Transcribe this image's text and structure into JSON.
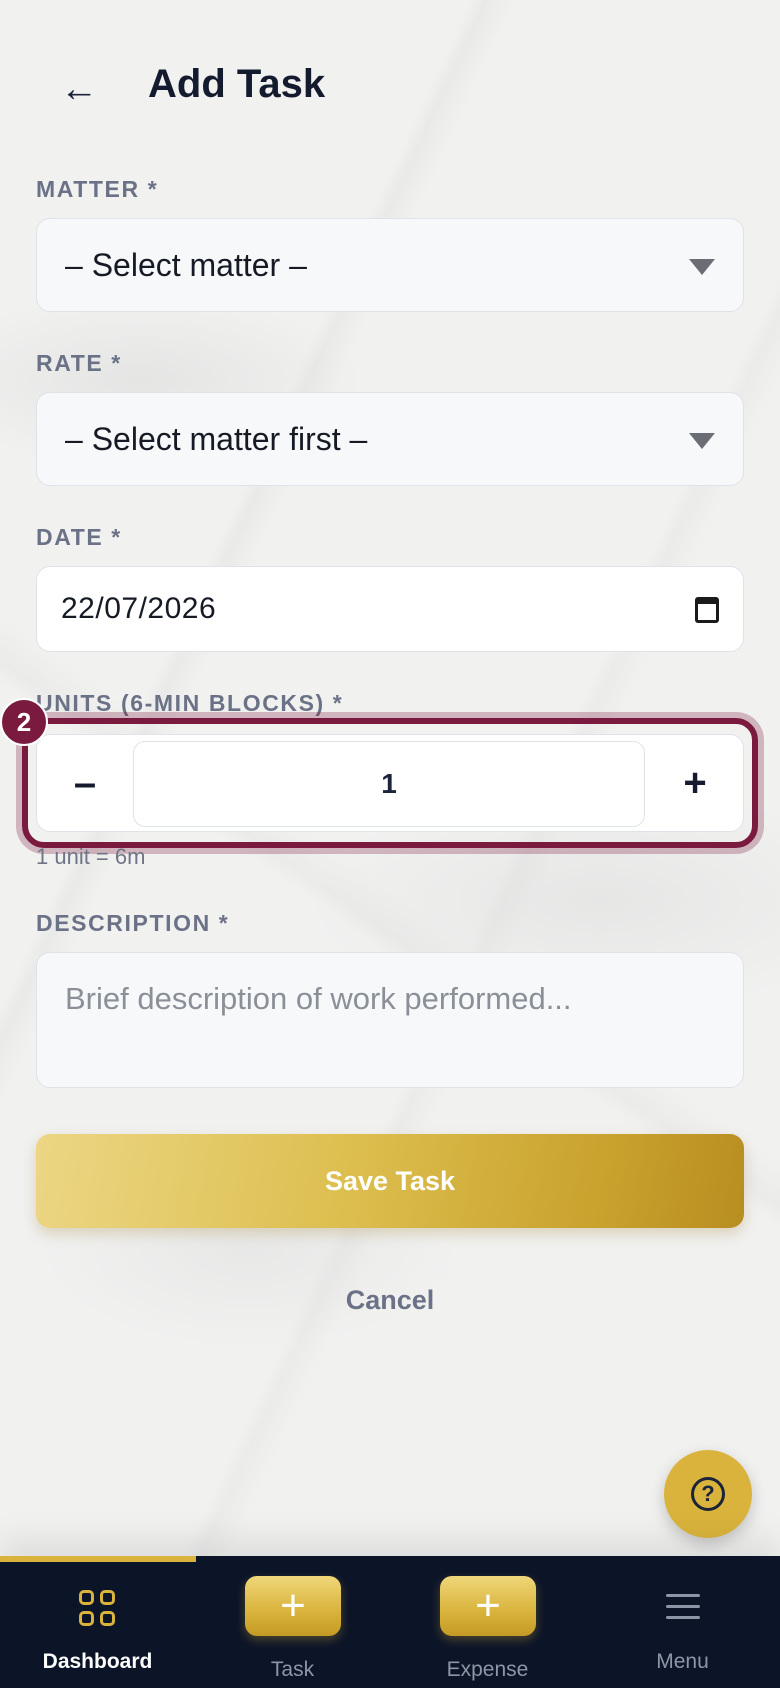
{
  "header": {
    "back_icon": "←",
    "title": "Add Task"
  },
  "form": {
    "matter": {
      "label": "MATTER *",
      "selected": "– Select matter –"
    },
    "rate": {
      "label": "RATE *",
      "selected": "– Select matter first –"
    },
    "date": {
      "label": "DATE *",
      "value": "22/07/2026"
    },
    "units": {
      "label": "UNITS (6-MIN BLOCKS) *",
      "minus": "–",
      "plus": "+",
      "value": "1",
      "hint": "1 unit = 6m",
      "badge": "2"
    },
    "description": {
      "label": "DESCRIPTION *",
      "placeholder": "Brief description of work performed..."
    },
    "save_label": "Save Task",
    "cancel_label": "Cancel"
  },
  "help": {
    "icon": "?"
  },
  "nav": {
    "items": [
      {
        "label": "Dashboard",
        "icon": "grid-icon"
      },
      {
        "label": "Task",
        "icon": "plus-icon"
      },
      {
        "label": "Expense",
        "icon": "plus-icon"
      },
      {
        "label": "Menu",
        "icon": "menu-icon"
      }
    ],
    "plus_glyph": "+"
  },
  "colors": {
    "accent_gold": "#d9b33b",
    "highlight": "#7a1a3e",
    "nav_bg": "#0c1428"
  }
}
